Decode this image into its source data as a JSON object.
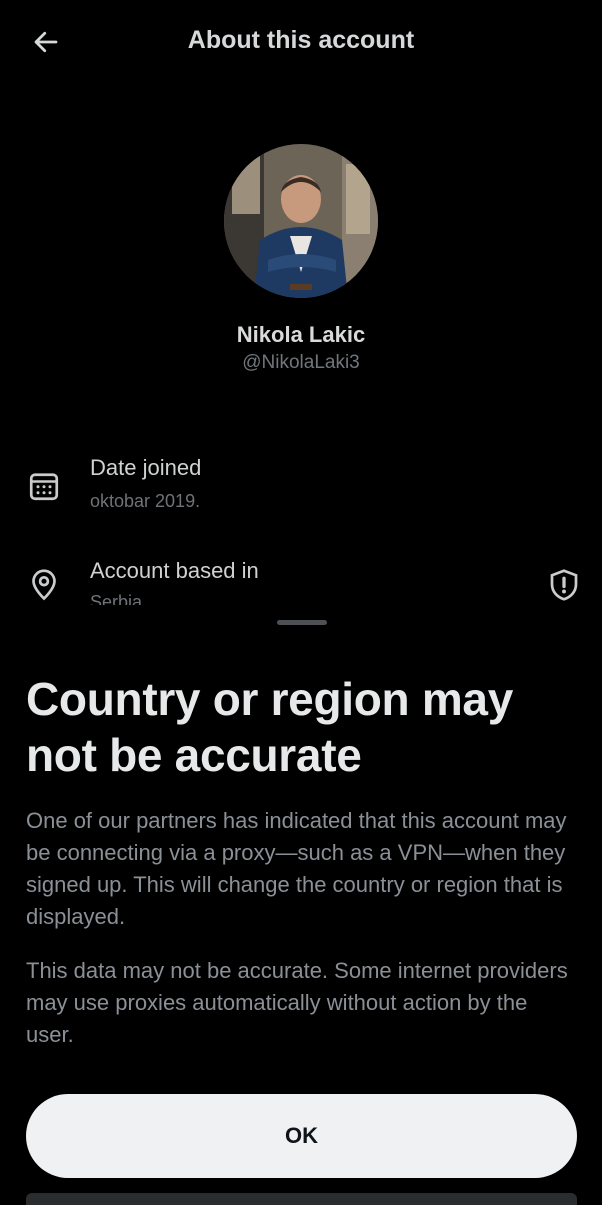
{
  "header": {
    "title": "About this account",
    "back_icon": "arrow-left-icon"
  },
  "profile": {
    "name": "Nikola Lakic",
    "handle": "@NikolaLaki3"
  },
  "info": {
    "date_joined_label": "Date joined",
    "date_joined_value": "oktobar 2019.",
    "account_based_label": "Account based in",
    "account_based_value": "Serbia"
  },
  "sheet": {
    "title": "Country or region may not be accurate",
    "paragraph1": "One of our partners has indicated that this account may be connecting via a proxy—such as a VPN—when they signed up. This will change the country or region that is displayed.",
    "paragraph2": "This data may not be accurate. Some internet providers may use proxies automatically without action by the user.",
    "ok_label": "OK"
  },
  "colors": {
    "background": "#000000",
    "primary_text": "#e7e9ea",
    "secondary_text": "#71767b",
    "button_bg": "#eff1f2"
  }
}
